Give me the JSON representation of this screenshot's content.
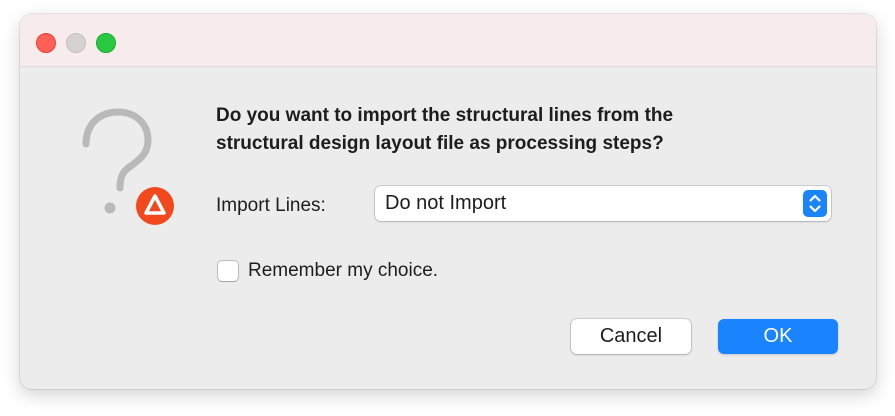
{
  "window": {
    "controls": [
      "close",
      "minimize",
      "zoom"
    ]
  },
  "dialog": {
    "icon": "question-mark-with-app-badge-icon",
    "message": "Do you want to import the structural lines from the\nstructural design layout file as processing steps?",
    "import_lines": {
      "label": "Import Lines:",
      "selected": "Do not Import"
    },
    "remember": {
      "label": "Remember my choice.",
      "checked": false
    },
    "buttons": {
      "cancel": "Cancel",
      "ok": "OK"
    }
  },
  "colors": {
    "accent": "#1a84ff",
    "badge": "#f2481e",
    "close": "#ff5f57",
    "zoom": "#28c840"
  }
}
